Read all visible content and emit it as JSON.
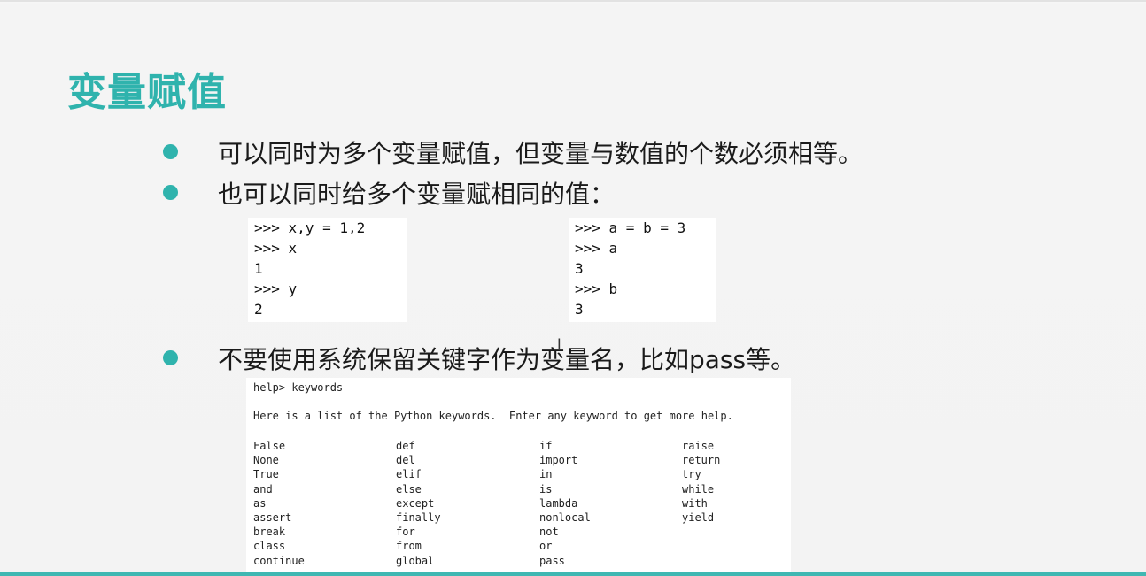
{
  "slide": {
    "title": "变量赋值",
    "bullets": [
      "可以同时为多个变量赋值，但变量与数值的个数必须相等。",
      "也可以同时给多个变量赋相同的值：",
      "不要使用系统保留关键字作为变量名，比如pass等。"
    ],
    "code_left": [
      ">>> x,y = 1,2",
      ">>> x",
      "1",
      ">>> y",
      "2"
    ],
    "code_right": [
      ">>> a = b = 3",
      ">>> a",
      "3",
      ">>> b",
      "3"
    ],
    "keywords_box": {
      "prompt": "help> keywords",
      "intro": "Here is a list of the Python keywords.  Enter any keyword to get more help.",
      "columns": [
        [
          "False",
          "None",
          "True",
          "and",
          "as",
          "assert",
          "break",
          "class",
          "continue"
        ],
        [
          "def",
          "del",
          "elif",
          "else",
          "except",
          "finally",
          "for",
          "from",
          "global"
        ],
        [
          "if",
          "import",
          "in",
          "is",
          "lambda",
          "nonlocal",
          "not",
          "or",
          "pass"
        ],
        [
          "raise",
          "return",
          "try",
          "while",
          "with",
          "yield"
        ]
      ]
    }
  },
  "colors": {
    "accent": "#2fb3ad",
    "text": "#1a1a1a"
  }
}
